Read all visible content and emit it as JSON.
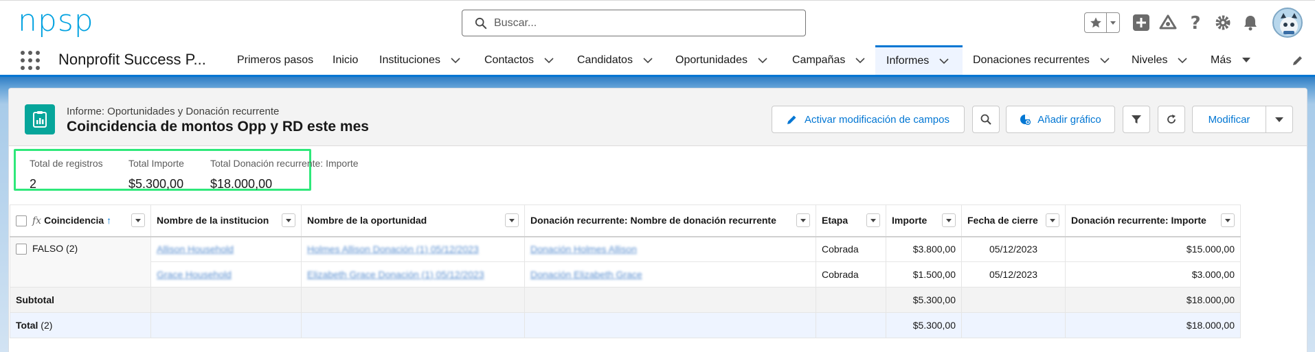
{
  "header": {
    "logo_text": "npsp",
    "search_placeholder": "Buscar...",
    "icons": [
      "favorites-star-icon",
      "chevron-down-icon",
      "add-icon",
      "trailhead-icon",
      "help-icon",
      "settings-icon",
      "notifications-bell-icon",
      "avatar"
    ]
  },
  "nav": {
    "app_name": "Nonprofit Success P...",
    "items": [
      {
        "label": "Primeros pasos",
        "has_menu": false
      },
      {
        "label": "Inicio",
        "has_menu": false
      },
      {
        "label": "Instituciones",
        "has_menu": true
      },
      {
        "label": "Contactos",
        "has_menu": true
      },
      {
        "label": "Candidatos",
        "has_menu": true
      },
      {
        "label": "Oportunidades",
        "has_menu": true
      },
      {
        "label": "Campañas",
        "has_menu": true
      },
      {
        "label": "Informes",
        "has_menu": true,
        "active": true
      },
      {
        "label": "Donaciones recurrentes",
        "has_menu": true
      },
      {
        "label": "Niveles",
        "has_menu": true
      },
      {
        "label": "Más",
        "has_menu": true
      }
    ]
  },
  "report": {
    "type_label": "Informe: Oportunidades y Donación recurrente",
    "title": "Coincidencia de montos Opp y RD este mes",
    "buttons": {
      "inline_edit": "Activar modificación de campos",
      "add_chart": "Añadir gráfico",
      "edit": "Modificar"
    },
    "summary": [
      {
        "label": "Total de registros",
        "value": "2"
      },
      {
        "label": "Total Importe",
        "value": "$5.300,00"
      },
      {
        "label": "Total Donación recurrente: Importe",
        "value": "$18.000,00"
      }
    ],
    "columns": [
      "Coincidencia",
      "Nombre de la institucion",
      "Nombre de la oportunidad",
      "Donación recurrente: Nombre de donación recurrente",
      "Etapa",
      "Importe",
      "Fecha de cierre",
      "Donación recurrente: Importe"
    ],
    "group": {
      "label": "FALSO",
      "count": "(2)"
    },
    "rows": [
      {
        "institution": "Allison Household",
        "opportunity": "Holmes Allison Donación (1) 05/12/2023",
        "recurring_name": "Donación Holmes Allison",
        "stage": "Cobrada",
        "amount": "$3.800,00",
        "close_date": "05/12/2023",
        "rd_amount": "$15.000,00"
      },
      {
        "institution": "Grace Household",
        "opportunity": "Elizabeth Grace Donación (1) 05/12/2023",
        "recurring_name": "Donación Elizabeth Grace",
        "stage": "Cobrada",
        "amount": "$1.500,00",
        "close_date": "05/12/2023",
        "rd_amount": "$3.000,00"
      }
    ],
    "subtotal": {
      "label": "Subtotal",
      "amount": "$5.300,00",
      "rd_amount": "$18.000,00"
    },
    "total": {
      "label": "Total",
      "count": "(2)",
      "amount": "$5.300,00",
      "rd_amount": "$18.000,00"
    }
  },
  "colors": {
    "brand_blue": "#0176d3",
    "report_icon": "#06a59a",
    "highlight": "#2ee87a",
    "logo": "#00a1e0"
  }
}
